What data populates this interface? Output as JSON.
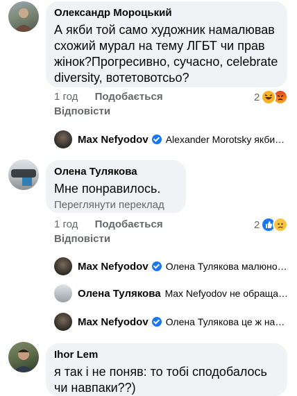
{
  "comments": [
    {
      "author": "Олександр Мороцький",
      "text": "А якби той само художник намалював схожий мурал на тему ЛГБТ чи прав жінок?Прогресивно, сучасно, celebrate diversity, вотетовотсьо?",
      "time": "1 год",
      "like_label": "Подобається",
      "reply_label": "Відповісти",
      "reaction_count": "2",
      "reactions": [
        "haha-icon",
        "angry-icon"
      ],
      "replies": [
        {
          "name": "Max Nefyodov",
          "verified": true,
          "snippet": "Alexander Morotsky якби…"
        }
      ]
    },
    {
      "author": "Олена Тулякова",
      "text": "Мне понравилось.",
      "translate_label": "Переглянути переклад",
      "time": "1 год",
      "like_label": "Подобається",
      "reply_label": "Відповісти",
      "reaction_count": "2",
      "reactions": [
        "like-icon",
        "sad-icon"
      ],
      "replies": [
        {
          "name": "Max Nefyodov",
          "verified": true,
          "snippet": "Олена Тулякова малюно…"
        },
        {
          "name": "Олена Тулякова",
          "verified": false,
          "snippet": "Max Nefyodov не обраща…"
        },
        {
          "name": "Max Nefyodov",
          "verified": true,
          "snippet": "Олена Тулякова це ж на…"
        }
      ]
    },
    {
      "author": "Ihor Lem",
      "text": "я так і не поняв: то тобі сподобалось чи навпаки??)"
    }
  ],
  "colors": {
    "bubble": "#f0f2f5",
    "meta": "#65676b",
    "verified": "#1877f2",
    "like": "#1877f2",
    "haha": "#f7b125",
    "angry": "#e9710f"
  }
}
